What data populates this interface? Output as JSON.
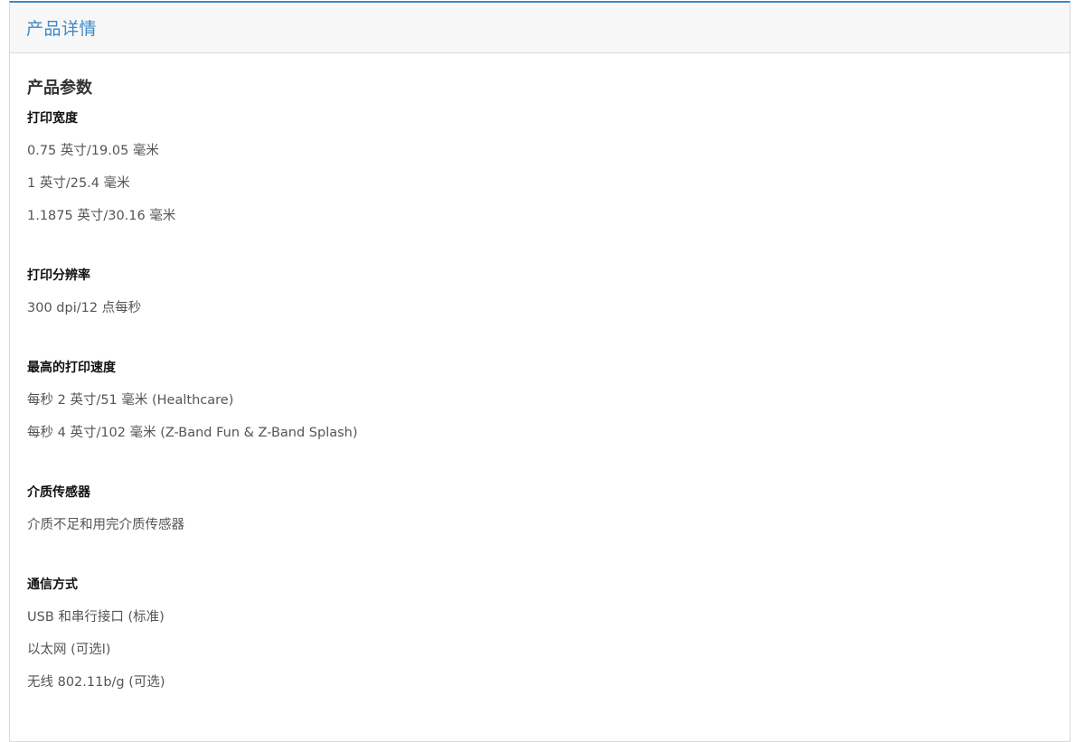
{
  "header": {
    "title": "产品详情"
  },
  "section": {
    "title": "产品参数"
  },
  "specs": [
    {
      "label": "打印宽度",
      "values": [
        "0.75 英寸/19.05 毫米",
        "1 英寸/25.4 毫米",
        "1.1875 英寸/30.16 毫米"
      ]
    },
    {
      "label": "打印分辨率",
      "values": [
        "300 dpi/12 点每秒"
      ]
    },
    {
      "label": "最高的打印速度",
      "values": [
        "每秒 2 英寸/51 毫米  (Healthcare)",
        "每秒 4 英寸/102 毫米  (Z-Band Fun & Z-Band Splash)"
      ]
    },
    {
      "label": "介质传感器",
      "values": [
        "介质不足和用完介质传感器"
      ]
    },
    {
      "label": "通信方式",
      "values": [
        "USB 和串行接口 (标准)",
        "以太网 (可选l)",
        "无线 802.11b/g  (可选)"
      ]
    }
  ],
  "colors": {
    "accent": "#3a88c9",
    "header_bg": "#f7f7f7",
    "label_text": "#111111",
    "value_text": "#555555"
  }
}
